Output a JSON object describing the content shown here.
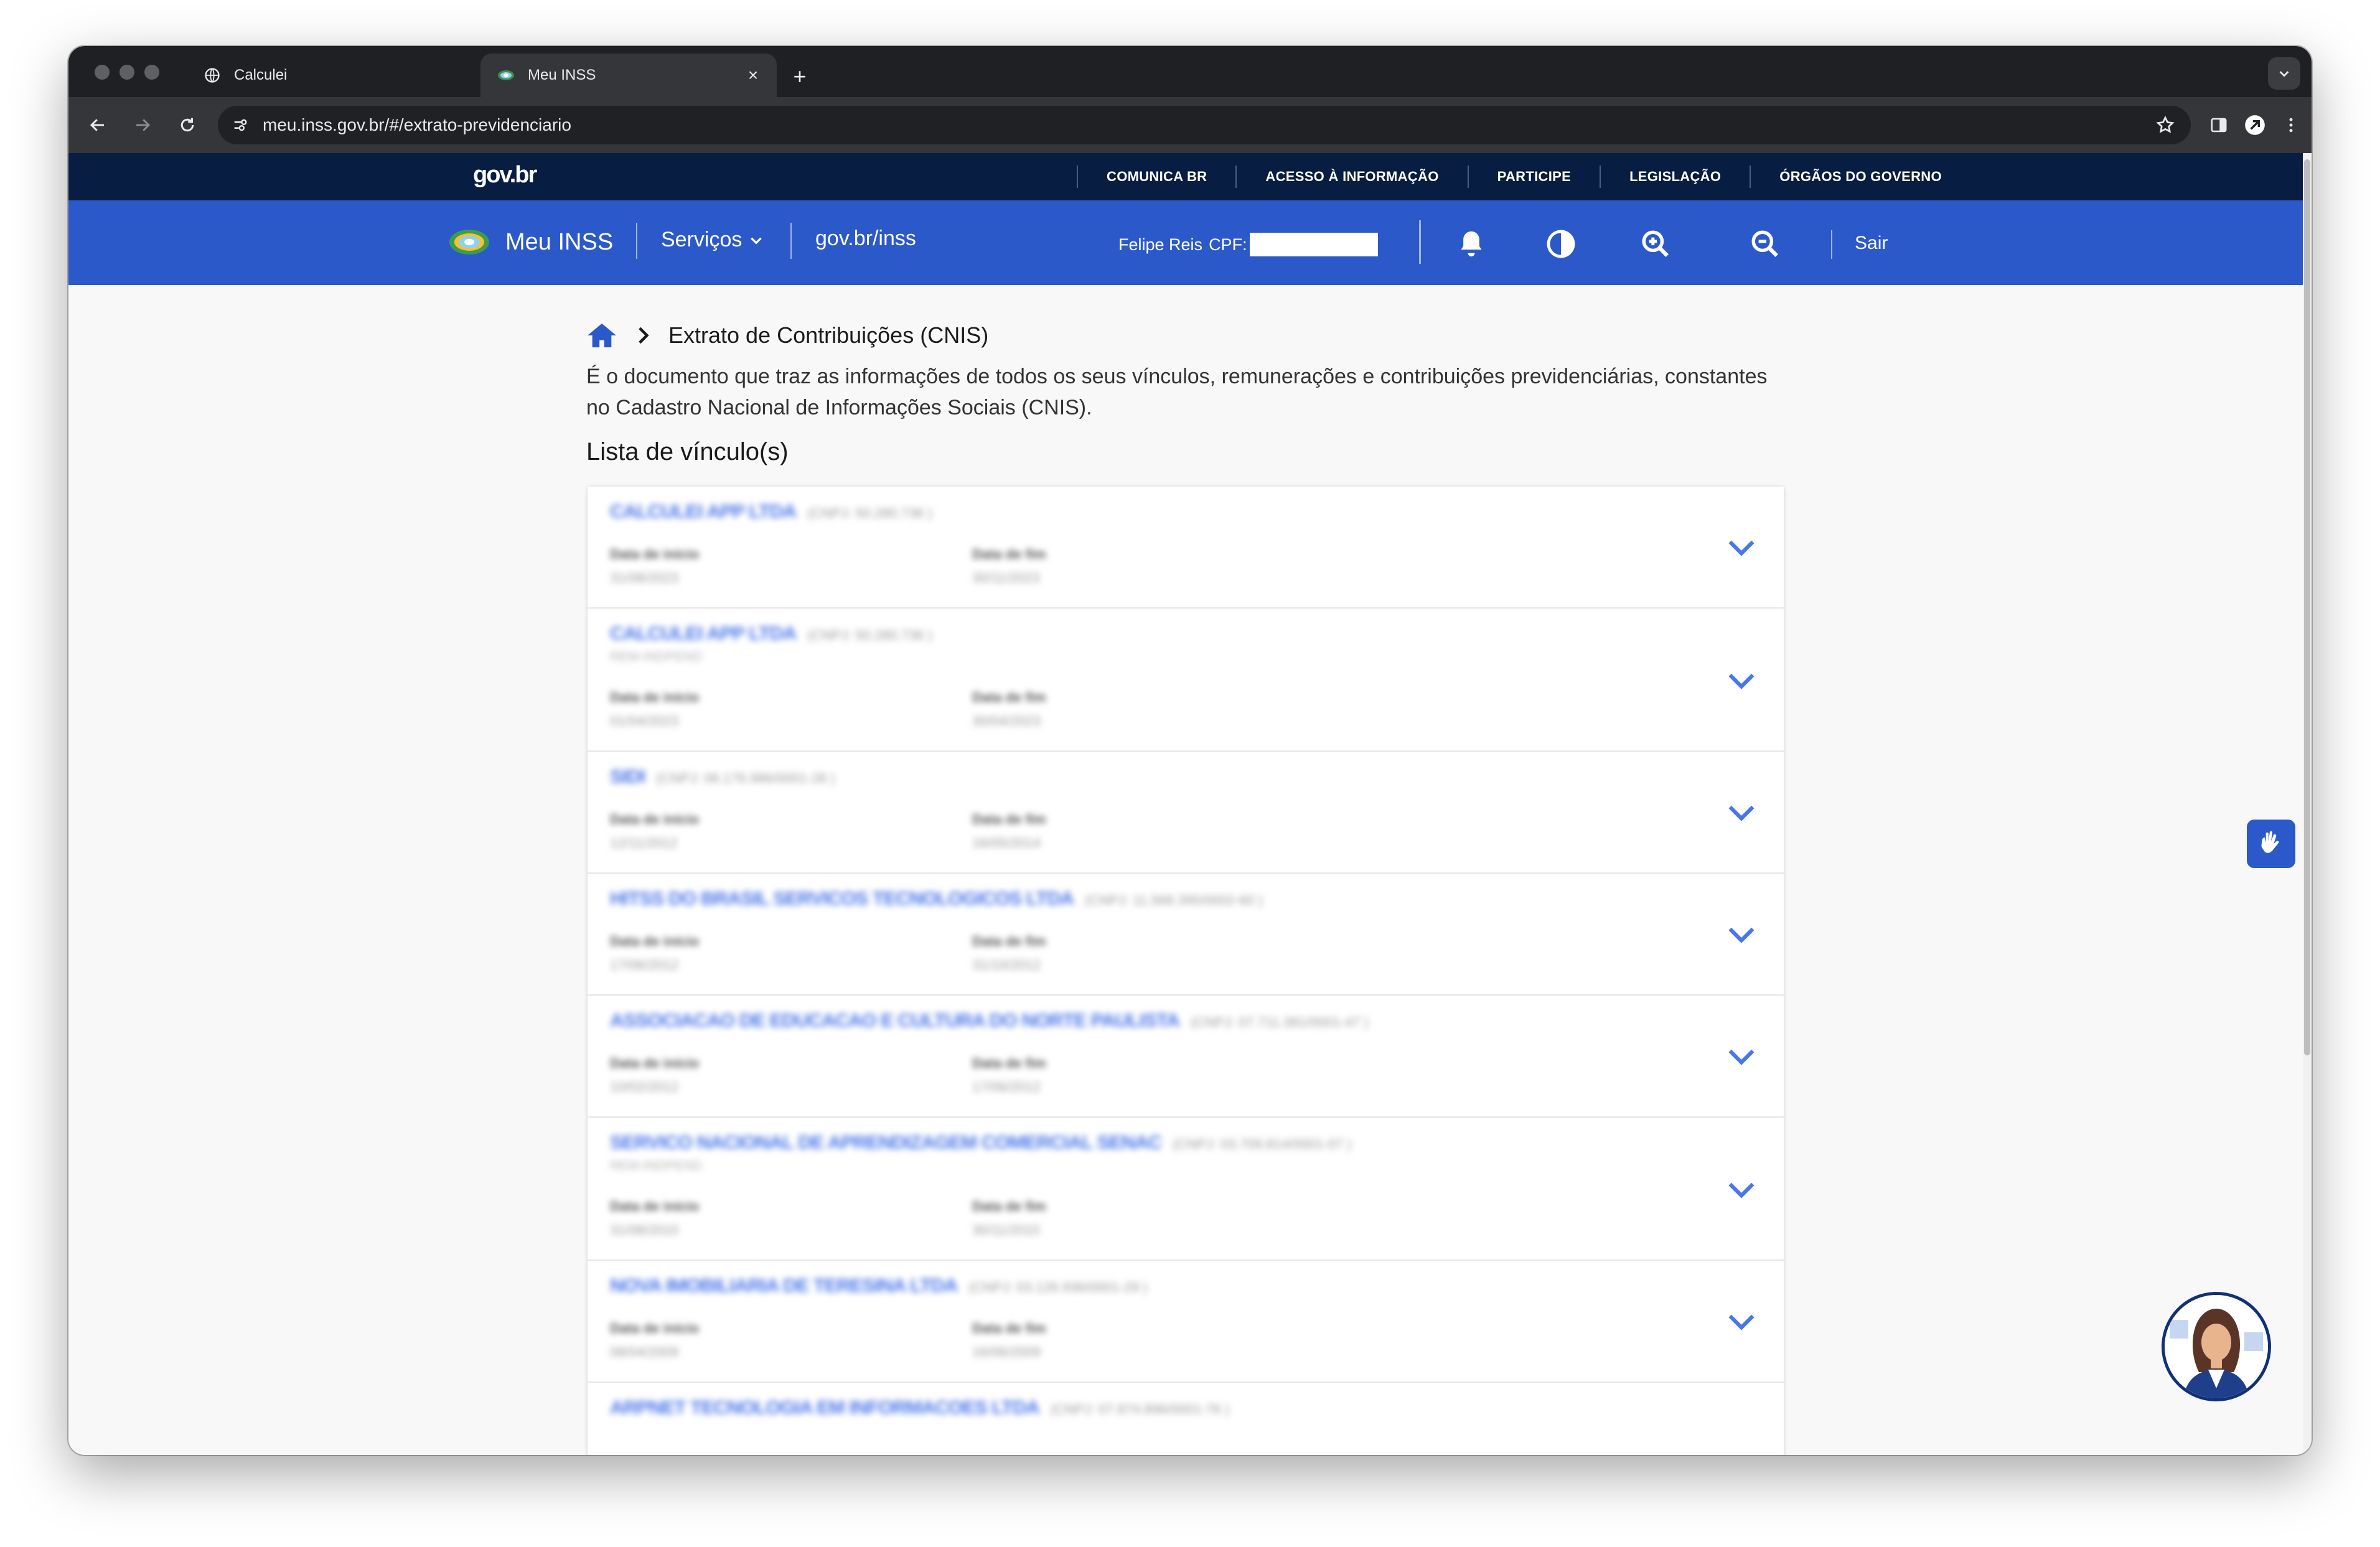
{
  "browser": {
    "tabs": [
      {
        "title": "Calculei",
        "active": false
      },
      {
        "title": "Meu INSS",
        "active": true
      }
    ],
    "new_tab": "+",
    "url": "meu.inss.gov.br/#/extrato-previdenciario"
  },
  "gov_header": {
    "logo": "gov.br",
    "links": [
      "COMUNICA BR",
      "ACESSO À INFORMAÇÃO",
      "PARTICIPE",
      "LEGISLAÇÃO",
      "ÓRGÃOS DO GOVERNO"
    ]
  },
  "inss_header": {
    "title": "Meu INSS",
    "servicos": "Serviços",
    "govlink": "gov.br/inss",
    "user_name": "Felipe Reis",
    "cpf_label": "CPF:",
    "sair": "Sair"
  },
  "page": {
    "breadcrumb": "Extrato de Contribuições (CNIS)",
    "description": "É o documento que traz as informações de todos os seus vínculos, remunerações e contribuições previdenciárias, constantes no Cadastro Nacional de Informações Sociais (CNIS).",
    "list_title": "Lista de vínculo(s)"
  },
  "vinculos": [
    {
      "name": "CALCULEI APP LTDA",
      "cnpj": "(CNPJ: 50.280.736 )",
      "status": "",
      "start_label": "Data de início",
      "start": "31/08/2023",
      "end_label": "Data de fim",
      "end": "30/11/2023"
    },
    {
      "name": "CALCULEI APP LTDA",
      "cnpj": "(CNPJ: 50.280.736 )",
      "status": "REM-INDPEND",
      "start_label": "Data de início",
      "start": "01/04/2023",
      "end_label": "Data de fim",
      "end": "30/04/2023"
    },
    {
      "name": "SIDI",
      "cnpj": "(CNPJ: 06.176.986/0001-28 )",
      "status": "",
      "start_label": "Data de início",
      "start": "12/11/2012",
      "end_label": "Data de fim",
      "end": "16/05/2014"
    },
    {
      "name": "HITSS DO BRASIL SERVICOS TECNOLOGICOS LTDA",
      "cnpj": "(CNPJ: 11.568.395/0002-60 )",
      "status": "",
      "start_label": "Data de início",
      "start": "17/06/2012",
      "end_label": "Data de fim",
      "end": "31/10/2012"
    },
    {
      "name": "ASSOCIACAO DE EDUCACAO E CULTURA DO NORTE PAULISTA",
      "cnpj": "(CNPJ: 07.711.381/0001-47 )",
      "status": "",
      "start_label": "Data de início",
      "start": "10/02/2012",
      "end_label": "Data de fim",
      "end": "17/06/2012"
    },
    {
      "name": "SERVICO NACIONAL DE APRENDIZAGEM COMERCIAL SENAC",
      "cnpj": "(CNPJ: 03.709.814/0001-07 )",
      "status": "REM-INDPEND",
      "start_label": "Data de início",
      "start": "31/08/2010",
      "end_label": "Data de fim",
      "end": "30/11/2010"
    },
    {
      "name": "NOVA IMOBILIARIA DE TERESINA LTDA",
      "cnpj": "(CNPJ: 03.126.936/0001-29 )",
      "status": "",
      "start_label": "Data de início",
      "start": "08/04/2009",
      "end_label": "Data de fim",
      "end": "16/06/2009"
    },
    {
      "name": "ARPNET TECNOLOGIA EM INFORMACOES LTDA",
      "cnpj": "(CNPJ: 07.874.896/0001-76 )",
      "status": "",
      "start_label": "",
      "start": "",
      "end_label": "",
      "end": ""
    }
  ],
  "icons": {
    "tab1": "globe-icon",
    "tab2": "inss-favicon-icon",
    "home": "home-icon",
    "notifications": "bell-icon",
    "contrast": "contrast-icon",
    "zoom_in": "zoom-in-icon",
    "zoom_out": "zoom-out-icon",
    "vlibras": "sign-language-icon",
    "assistant": "assistant-avatar-icon"
  },
  "colors": {
    "gov_bar": "#071d41",
    "inss_bar": "#2c59c9",
    "link_blue": "#4a77e8",
    "browser_dark": "#1f2023"
  }
}
